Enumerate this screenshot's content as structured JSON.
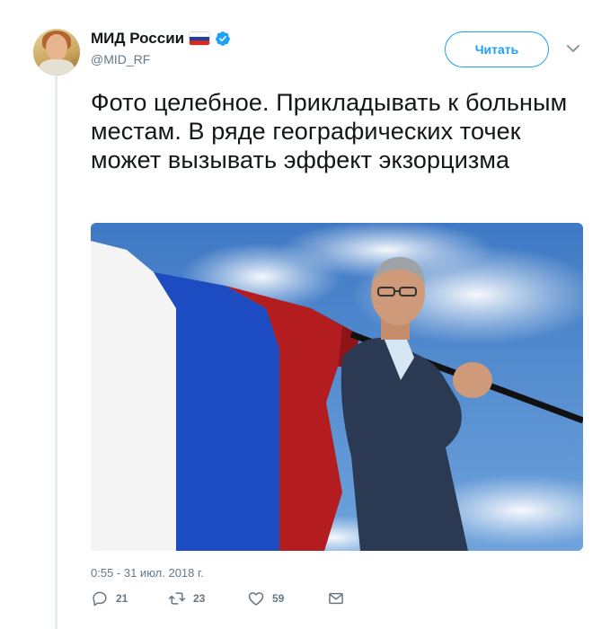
{
  "account": {
    "name": "МИД России",
    "handle": "@MID_RF",
    "flag_colors": [
      "#ffffff",
      "#1c3fa8",
      "#d52b1e"
    ],
    "verified_color": "#1da1f2"
  },
  "follow_button": {
    "label": "Читать"
  },
  "tweet": {
    "text": "Фото целебное. Прикладывать к больным местам. В ряде географических точек может вызывать эффект экзорцизма",
    "timestamp": "0:55 - 31 июл. 2018 г."
  },
  "actions": {
    "reply": {
      "icon": "reply-icon",
      "count": "21"
    },
    "retweet": {
      "icon": "retweet-icon",
      "count": "23"
    },
    "like": {
      "icon": "heart-icon",
      "count": "59"
    },
    "dm": {
      "icon": "envelope-icon"
    }
  },
  "colors": {
    "accent": "#1da1f2",
    "muted": "#657786",
    "text": "#14171a"
  }
}
